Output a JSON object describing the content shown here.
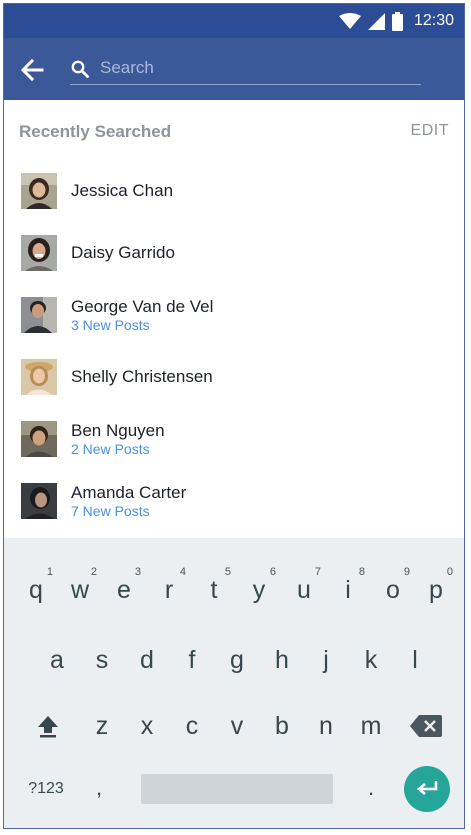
{
  "status_bar": {
    "time": "12:30"
  },
  "search": {
    "placeholder": "Search",
    "value": ""
  },
  "recent": {
    "title": "Recently Searched",
    "edit_label": "EDIT",
    "items": [
      {
        "name": "Jessica Chan",
        "subtitle": ""
      },
      {
        "name": "Daisy Garrido",
        "subtitle": ""
      },
      {
        "name": "George Van de Vel",
        "subtitle": "3 New Posts"
      },
      {
        "name": "Shelly Christensen",
        "subtitle": ""
      },
      {
        "name": "Ben Nguyen",
        "subtitle": "2 New Posts"
      },
      {
        "name": "Amanda Carter",
        "subtitle": "7 New Posts"
      }
    ]
  },
  "keyboard": {
    "row1": [
      "q",
      "w",
      "e",
      "r",
      "t",
      "y",
      "u",
      "i",
      "o",
      "p"
    ],
    "row1_hints": [
      "1",
      "2",
      "3",
      "4",
      "5",
      "6",
      "7",
      "8",
      "9",
      "0"
    ],
    "row2": [
      "a",
      "s",
      "d",
      "f",
      "g",
      "h",
      "j",
      "k",
      "l"
    ],
    "row3": [
      "z",
      "x",
      "c",
      "v",
      "b",
      "n",
      "m"
    ],
    "symbols_label": "?123",
    "comma": ",",
    "period": "."
  },
  "colors": {
    "status_bar": "#2c4c95",
    "app_bar": "#3b5998",
    "link_blue": "#4a90e2",
    "enter_key": "#26a69a"
  }
}
